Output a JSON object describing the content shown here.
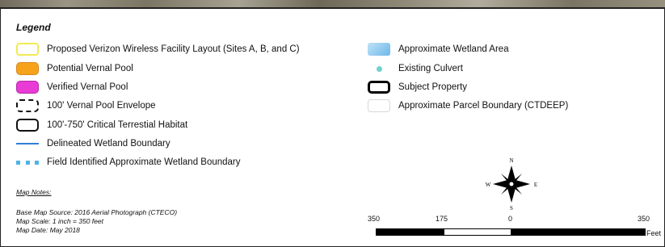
{
  "legend": {
    "title": "Legend",
    "items_left": [
      {
        "label": "Proposed Verizon Wireless Facility Layout (Sites A, B, and C)",
        "symbol": "yellow-outline-box",
        "color": "#f3ea54"
      },
      {
        "label": "Potential Vernal Pool",
        "symbol": "orange-filled-box",
        "color": "#f6a31b"
      },
      {
        "label": "Verified Vernal Pool",
        "symbol": "magenta-filled-box",
        "color": "#e93bd5"
      },
      {
        "label": "100' Vernal Pool Envelope",
        "symbol": "dashed-black-box"
      },
      {
        "label": "100'-750' Critical Terrestial Habitat",
        "symbol": "solid-black-box"
      },
      {
        "label": "Delineated Wetland Boundary",
        "symbol": "blue-line",
        "color": "#2f7fd8"
      },
      {
        "label": "Field Identified Approximate Wetland Boundary",
        "symbol": "blue-dotted-line",
        "color": "#4fb3e8"
      }
    ],
    "items_right": [
      {
        "label": "Approximate Wetland Area",
        "symbol": "light-blue-fill",
        "color": "#8ccbf0"
      },
      {
        "label": "Existing Culvert",
        "symbol": "teal-dot",
        "color": "#6fd2d0"
      },
      {
        "label": "Subject Property",
        "symbol": "thick-black-box"
      },
      {
        "label": "Approximate Parcel Boundary (CTDEEP)",
        "symbol": "light-grey-box"
      }
    ]
  },
  "map_notes": {
    "heading": "Map Notes:",
    "lines": [
      "Base Map Source: 2016 Aerial Photograph (CTECO)",
      "Map Scale: 1 inch = 350 feet",
      "Map Date: May 2018"
    ]
  },
  "compass": {
    "n": "N",
    "s": "S",
    "e": "E",
    "w": "W"
  },
  "scale_bar": {
    "tick_labels": [
      "350",
      "175",
      "0",
      "350"
    ],
    "unit": "Feet"
  }
}
